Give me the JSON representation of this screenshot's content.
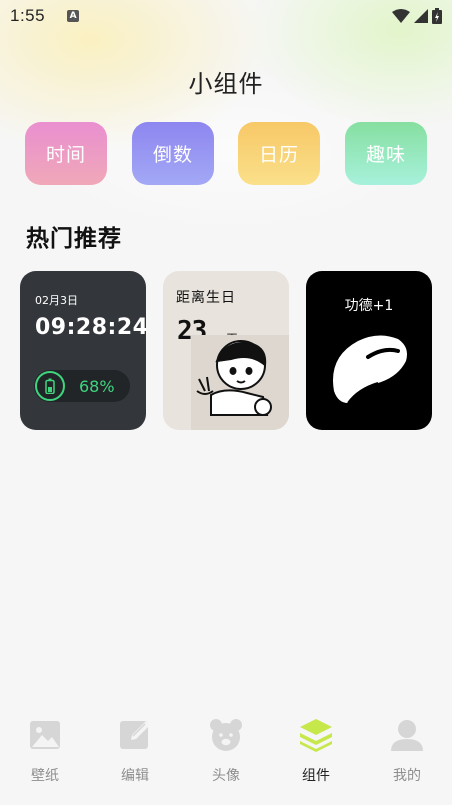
{
  "status_bar": {
    "time": "1:55",
    "notification_badge": "A"
  },
  "page": {
    "title": "小组件"
  },
  "categories": [
    {
      "label": "时间",
      "color": "#e98fd0"
    },
    {
      "label": "倒数",
      "color": "#8d86f0"
    },
    {
      "label": "日历",
      "color": "#f7c867"
    },
    {
      "label": "趣味",
      "color": "#86dfa0"
    }
  ],
  "section": {
    "title": "热门推荐"
  },
  "widgets": {
    "clock": {
      "date": "02月3日",
      "time": "09:28:24",
      "battery": "68%",
      "battery_icon": "battery-icon"
    },
    "countdown": {
      "label": "距离生日",
      "days": "23",
      "unit": "天"
    },
    "merit": {
      "label": "功德+1",
      "icon": "wooden-fish-icon"
    }
  },
  "tabbar": {
    "items": [
      {
        "label": "壁纸",
        "icon": "image-icon",
        "active": false
      },
      {
        "label": "编辑",
        "icon": "edit-icon",
        "active": false
      },
      {
        "label": "头像",
        "icon": "bear-icon",
        "active": false
      },
      {
        "label": "组件",
        "icon": "layers-icon",
        "active": true
      },
      {
        "label": "我的",
        "icon": "user-icon",
        "active": false
      }
    ],
    "active_color": "#c7e84a"
  }
}
